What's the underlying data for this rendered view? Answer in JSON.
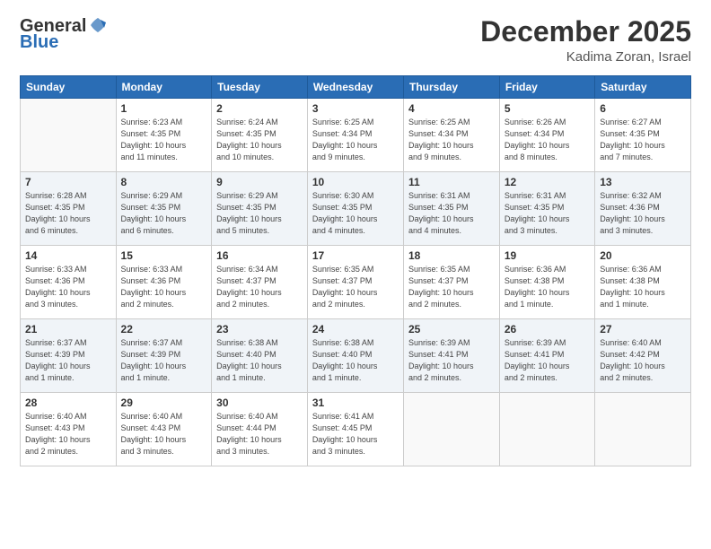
{
  "header": {
    "logo_general": "General",
    "logo_blue": "Blue",
    "month_title": "December 2025",
    "location": "Kadima Zoran, Israel"
  },
  "days_of_week": [
    "Sunday",
    "Monday",
    "Tuesday",
    "Wednesday",
    "Thursday",
    "Friday",
    "Saturday"
  ],
  "weeks": [
    [
      {
        "day": "",
        "info": ""
      },
      {
        "day": "1",
        "info": "Sunrise: 6:23 AM\nSunset: 4:35 PM\nDaylight: 10 hours\nand 11 minutes."
      },
      {
        "day": "2",
        "info": "Sunrise: 6:24 AM\nSunset: 4:35 PM\nDaylight: 10 hours\nand 10 minutes."
      },
      {
        "day": "3",
        "info": "Sunrise: 6:25 AM\nSunset: 4:34 PM\nDaylight: 10 hours\nand 9 minutes."
      },
      {
        "day": "4",
        "info": "Sunrise: 6:25 AM\nSunset: 4:34 PM\nDaylight: 10 hours\nand 9 minutes."
      },
      {
        "day": "5",
        "info": "Sunrise: 6:26 AM\nSunset: 4:34 PM\nDaylight: 10 hours\nand 8 minutes."
      },
      {
        "day": "6",
        "info": "Sunrise: 6:27 AM\nSunset: 4:35 PM\nDaylight: 10 hours\nand 7 minutes."
      }
    ],
    [
      {
        "day": "7",
        "info": "Sunrise: 6:28 AM\nSunset: 4:35 PM\nDaylight: 10 hours\nand 6 minutes."
      },
      {
        "day": "8",
        "info": "Sunrise: 6:29 AM\nSunset: 4:35 PM\nDaylight: 10 hours\nand 6 minutes."
      },
      {
        "day": "9",
        "info": "Sunrise: 6:29 AM\nSunset: 4:35 PM\nDaylight: 10 hours\nand 5 minutes."
      },
      {
        "day": "10",
        "info": "Sunrise: 6:30 AM\nSunset: 4:35 PM\nDaylight: 10 hours\nand 4 minutes."
      },
      {
        "day": "11",
        "info": "Sunrise: 6:31 AM\nSunset: 4:35 PM\nDaylight: 10 hours\nand 4 minutes."
      },
      {
        "day": "12",
        "info": "Sunrise: 6:31 AM\nSunset: 4:35 PM\nDaylight: 10 hours\nand 3 minutes."
      },
      {
        "day": "13",
        "info": "Sunrise: 6:32 AM\nSunset: 4:36 PM\nDaylight: 10 hours\nand 3 minutes."
      }
    ],
    [
      {
        "day": "14",
        "info": "Sunrise: 6:33 AM\nSunset: 4:36 PM\nDaylight: 10 hours\nand 3 minutes."
      },
      {
        "day": "15",
        "info": "Sunrise: 6:33 AM\nSunset: 4:36 PM\nDaylight: 10 hours\nand 2 minutes."
      },
      {
        "day": "16",
        "info": "Sunrise: 6:34 AM\nSunset: 4:37 PM\nDaylight: 10 hours\nand 2 minutes."
      },
      {
        "day": "17",
        "info": "Sunrise: 6:35 AM\nSunset: 4:37 PM\nDaylight: 10 hours\nand 2 minutes."
      },
      {
        "day": "18",
        "info": "Sunrise: 6:35 AM\nSunset: 4:37 PM\nDaylight: 10 hours\nand 2 minutes."
      },
      {
        "day": "19",
        "info": "Sunrise: 6:36 AM\nSunset: 4:38 PM\nDaylight: 10 hours\nand 1 minute."
      },
      {
        "day": "20",
        "info": "Sunrise: 6:36 AM\nSunset: 4:38 PM\nDaylight: 10 hours\nand 1 minute."
      }
    ],
    [
      {
        "day": "21",
        "info": "Sunrise: 6:37 AM\nSunset: 4:39 PM\nDaylight: 10 hours\nand 1 minute."
      },
      {
        "day": "22",
        "info": "Sunrise: 6:37 AM\nSunset: 4:39 PM\nDaylight: 10 hours\nand 1 minute."
      },
      {
        "day": "23",
        "info": "Sunrise: 6:38 AM\nSunset: 4:40 PM\nDaylight: 10 hours\nand 1 minute."
      },
      {
        "day": "24",
        "info": "Sunrise: 6:38 AM\nSunset: 4:40 PM\nDaylight: 10 hours\nand 1 minute."
      },
      {
        "day": "25",
        "info": "Sunrise: 6:39 AM\nSunset: 4:41 PM\nDaylight: 10 hours\nand 2 minutes."
      },
      {
        "day": "26",
        "info": "Sunrise: 6:39 AM\nSunset: 4:41 PM\nDaylight: 10 hours\nand 2 minutes."
      },
      {
        "day": "27",
        "info": "Sunrise: 6:40 AM\nSunset: 4:42 PM\nDaylight: 10 hours\nand 2 minutes."
      }
    ],
    [
      {
        "day": "28",
        "info": "Sunrise: 6:40 AM\nSunset: 4:43 PM\nDaylight: 10 hours\nand 2 minutes."
      },
      {
        "day": "29",
        "info": "Sunrise: 6:40 AM\nSunset: 4:43 PM\nDaylight: 10 hours\nand 3 minutes."
      },
      {
        "day": "30",
        "info": "Sunrise: 6:40 AM\nSunset: 4:44 PM\nDaylight: 10 hours\nand 3 minutes."
      },
      {
        "day": "31",
        "info": "Sunrise: 6:41 AM\nSunset: 4:45 PM\nDaylight: 10 hours\nand 3 minutes."
      },
      {
        "day": "",
        "info": ""
      },
      {
        "day": "",
        "info": ""
      },
      {
        "day": "",
        "info": ""
      }
    ]
  ]
}
